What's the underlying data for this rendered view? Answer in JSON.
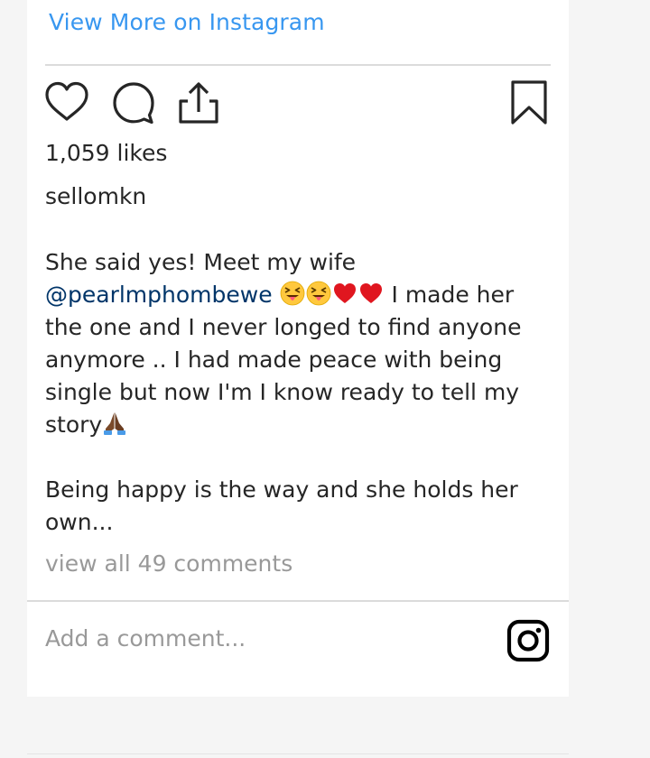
{
  "header": {
    "view_more_label": "View More on Instagram"
  },
  "actions": {
    "like_icon": "heart-outline-icon",
    "comment_icon": "comment-bubble-icon",
    "share_icon": "share-upload-icon",
    "save_icon": "bookmark-outline-icon"
  },
  "post": {
    "likes": "1,059 likes",
    "username": "sellomkn",
    "caption_line1_prefix": "She said yes! Meet my wife",
    "mention": "@pearlmphombewe",
    "emojis": [
      "squinting-face-with-tongue",
      "squinting-face-with-tongue",
      "red-heart",
      "red-heart",
      "folded-hands-dark-skin"
    ],
    "caption_after_emojis": " I made her the one and I never longed to find anyone anymore .. I had made peace with being single but now I'm I know ready to tell my story",
    "caption_paragraph2": "Being happy is the way and she holds her own...",
    "view_comments": "view all 49 comments"
  },
  "comment_bar": {
    "placeholder": "Add a comment...",
    "logo_icon": "instagram-logo-icon"
  },
  "colors": {
    "link_blue": "#3897f0",
    "mention_blue": "#003569",
    "text": "#262626",
    "muted": "#999999",
    "divider": "#dbdbdb"
  }
}
